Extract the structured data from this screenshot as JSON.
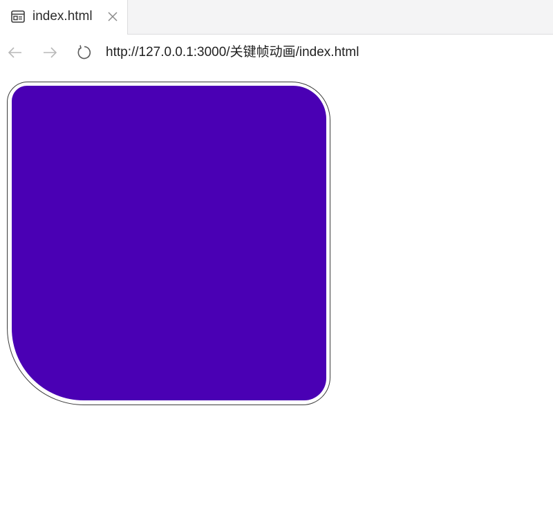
{
  "tab": {
    "title": "index.html",
    "icon": "page-icon"
  },
  "toolbar": {
    "back_icon": "arrow-left-icon",
    "forward_icon": "arrow-right-icon",
    "reload_icon": "reload-icon",
    "url": "http://127.0.0.1:3000/关键帧动画/index.html"
  },
  "content": {
    "shape_color": "#4a00b4"
  }
}
